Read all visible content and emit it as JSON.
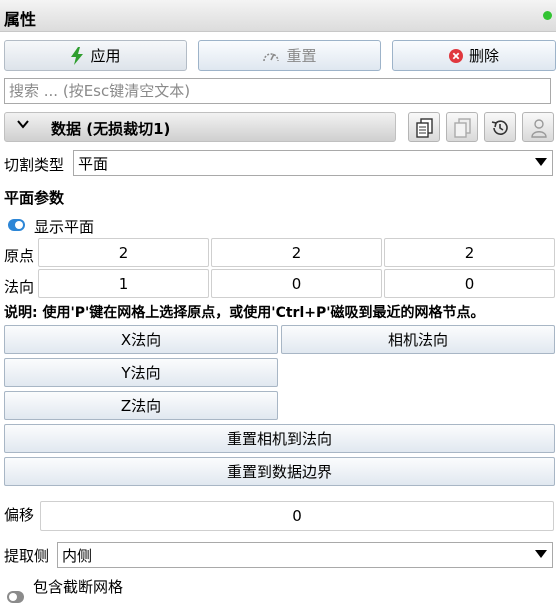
{
  "header": {
    "title": "属性",
    "status_color": "#33c433"
  },
  "toolbar": {
    "apply_label": "应用",
    "reset_label": "重置",
    "delete_label": "删除"
  },
  "search": {
    "placeholder": "搜索 ... (按Esc键清空文本)",
    "value": ""
  },
  "group": {
    "title": "数据 (无损裁切1)",
    "tool_icons": [
      "copy-icon",
      "paste-icon",
      "history-icon",
      "user-icon"
    ]
  },
  "clip_type": {
    "label": "切割类型",
    "value": "平面"
  },
  "plane_params": {
    "heading": "平面参数",
    "show_plane_label": "显示平面",
    "show_plane_on": true,
    "origin": {
      "label": "原点",
      "values": [
        "2",
        "2",
        "2"
      ]
    },
    "normal": {
      "label": "法向",
      "values": [
        "1",
        "0",
        "0"
      ]
    },
    "note": "说明: 使用'P'键在网格上选择原点，或使用'Ctrl+P'磁吸到最近的网格节点。"
  },
  "buttons": {
    "x_normal": "X法向",
    "camera_normal": "相机法向",
    "y_normal": "Y法向",
    "z_normal": "Z法向",
    "reset_camera": "重置相机到法向",
    "reset_bounds": "重置到数据边界"
  },
  "offset": {
    "label": "偏移",
    "value": "0"
  },
  "extract": {
    "label": "提取侧",
    "value": "内侧"
  },
  "crinkle": {
    "label": "包含截断网格",
    "on": false
  },
  "colors": {
    "apply_icon": "#2f9e2f",
    "delete_icon": "#e0383e",
    "toggle_on": "#2d86d6"
  }
}
